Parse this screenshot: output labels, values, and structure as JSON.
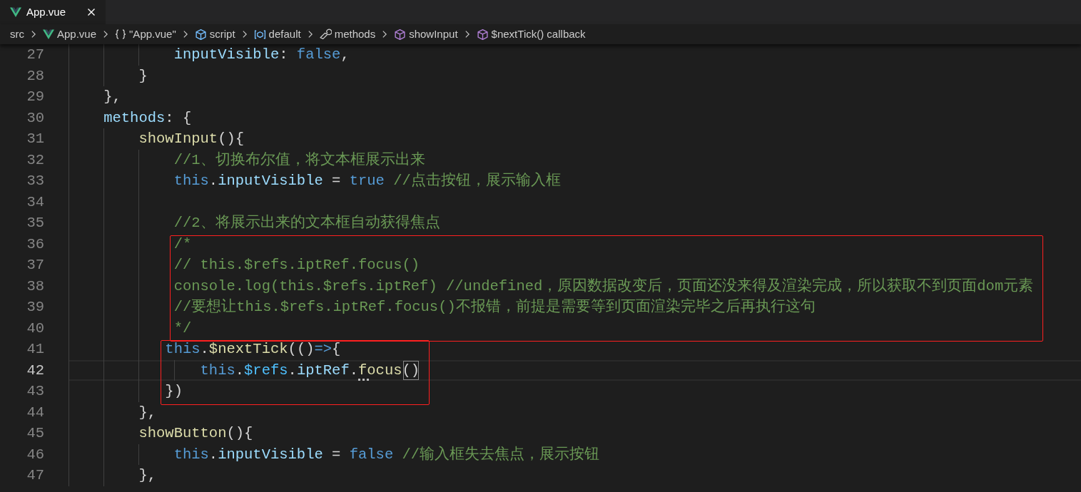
{
  "tabs": [
    {
      "label": "App.vue",
      "selected": true,
      "kind": "vue"
    }
  ],
  "breadcrumbs": [
    {
      "label": "src",
      "kind": "folder"
    },
    {
      "label": "App.vue",
      "kind": "vue"
    },
    {
      "label": "\"App.vue\"",
      "kind": "module"
    },
    {
      "label": "script",
      "kind": "element"
    },
    {
      "label": "default",
      "kind": "variable"
    },
    {
      "label": "methods",
      "kind": "property"
    },
    {
      "label": "showInput",
      "kind": "method"
    },
    {
      "label": "$nextTick() callback",
      "kind": "method"
    }
  ],
  "code": [
    {
      "kind": "plain",
      "lines": [
        {
          "number": "27",
          "current": false,
          "tokens": [
            {
              "t": "            inputVisible",
              "kind": "prop"
            },
            {
              "t": ": ",
              "kind": "punct"
            },
            {
              "t": "false",
              "kind": "kw"
            },
            {
              "t": ",",
              "kind": "punct"
            }
          ]
        },
        {
          "number": "28",
          "current": false,
          "tokens": [
            {
              "t": "        }",
              "kind": "punct"
            }
          ]
        },
        {
          "number": "29",
          "current": false,
          "tokens": [
            {
              "t": "    },",
              "kind": "punct"
            }
          ]
        },
        {
          "number": "30",
          "current": false,
          "tokens": [
            {
              "t": "    methods",
              "kind": "prop"
            },
            {
              "t": ": {",
              "kind": "punct"
            }
          ]
        },
        {
          "number": "31",
          "current": false,
          "tokens": [
            {
              "t": "        showInput",
              "kind": "func"
            },
            {
              "t": "(){",
              "kind": "punct"
            }
          ]
        },
        {
          "number": "32",
          "current": false,
          "tokens": [
            {
              "t": "            //1、切换布尔值，将文本框展示出来",
              "kind": "comment"
            }
          ]
        },
        {
          "number": "33",
          "current": false,
          "tokens": [
            {
              "t": "            this",
              "kind": "kw"
            },
            {
              "t": ".",
              "kind": "punct"
            },
            {
              "t": "inputVisible",
              "kind": "prop"
            },
            {
              "t": " = ",
              "kind": "punct"
            },
            {
              "t": "true",
              "kind": "kw"
            },
            {
              "t": " //点击按钮，展示输入框",
              "kind": "comment"
            }
          ]
        },
        {
          "number": "34",
          "current": false
        },
        {
          "number": "35",
          "current": false,
          "tokens": [
            {
              "t": "            //2、将展示出来的文本框自动获得焦点",
              "kind": "comment"
            }
          ]
        }
      ]
    },
    {
      "kind": "boxed",
      "lines": [
        {
          "number": "36",
          "current": false,
          "tokens": [
            {
              "t": "            /*",
              "kind": "comment"
            }
          ]
        },
        {
          "number": "37",
          "current": false,
          "tokens": [
            {
              "t": "            // this.$refs.iptRef.focus()",
              "kind": "comment"
            }
          ]
        },
        {
          "number": "38",
          "current": false,
          "tokens": [
            {
              "t": "            console.log(this.$refs.iptRef) //undefined，原因数据改变后，页面还没来得及渲染完成，所以获取不到页面dom元素",
              "kind": "comment"
            }
          ]
        },
        {
          "number": "39",
          "current": false,
          "tokens": [
            {
              "t": "            //要想让this.$refs.iptRef.focus()不报错，前提是需要等到页面渲染完毕之后再执行这句",
              "kind": "comment"
            }
          ]
        },
        {
          "number": "40",
          "current": false,
          "tokens": [
            {
              "t": "            */",
              "kind": "comment"
            }
          ]
        }
      ]
    },
    {
      "kind": "boxed",
      "lines": [
        {
          "number": "41",
          "current": false,
          "tokens": [
            {
              "t": "           this",
              "kind": "kw"
            },
            {
              "t": ".",
              "kind": "punct"
            },
            {
              "t": "$nextTick",
              "kind": "func"
            },
            {
              "t": "(()",
              "kind": "punct"
            },
            {
              "t": "=>",
              "kind": "kw"
            },
            {
              "t": "{",
              "kind": "punct"
            }
          ]
        },
        {
          "number": "42",
          "current": true,
          "tokens": [
            {
              "t": "               this",
              "kind": "kw"
            },
            {
              "t": ".",
              "kind": "punct"
            },
            {
              "t": "$refs",
              "kind": "var"
            },
            {
              "t": ".",
              "kind": "punct"
            },
            {
              "t": "iptRef",
              "kind": "prop"
            },
            {
              "t": ".",
              "kind": "punct"
            },
            {
              "t": "focus",
              "kind": "func",
              "suggestion": true
            },
            {
              "t": "()",
              "kind": "punct",
              "matched": true
            }
          ]
        },
        {
          "number": "43",
          "current": false,
          "tokens": [
            {
              "t": "           })",
              "kind": "punct"
            }
          ]
        }
      ]
    },
    {
      "kind": "plain",
      "lines": [
        {
          "number": "44",
          "current": false,
          "tokens": [
            {
              "t": "        },",
              "kind": "punct"
            }
          ]
        },
        {
          "number": "45",
          "current": false,
          "tokens": [
            {
              "t": "        showButton",
              "kind": "func"
            },
            {
              "t": "(){",
              "kind": "punct"
            }
          ]
        },
        {
          "number": "46",
          "current": false,
          "tokens": [
            {
              "t": "            this",
              "kind": "kw"
            },
            {
              "t": ".",
              "kind": "punct"
            },
            {
              "t": "inputVisible",
              "kind": "prop"
            },
            {
              "t": " = ",
              "kind": "punct"
            },
            {
              "t": "false",
              "kind": "kw"
            },
            {
              "t": " //输入框失去焦点，展示按钮",
              "kind": "comment"
            }
          ]
        },
        {
          "number": "47",
          "current": false,
          "tokens": [
            {
              "t": "        },",
              "kind": "punct"
            }
          ]
        }
      ]
    }
  ]
}
